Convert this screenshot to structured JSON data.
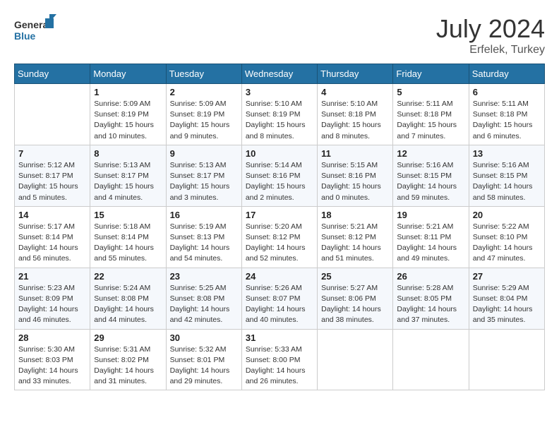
{
  "header": {
    "logo_line1": "General",
    "logo_line2": "Blue",
    "month_year": "July 2024",
    "location": "Erfelek, Turkey"
  },
  "weekdays": [
    "Sunday",
    "Monday",
    "Tuesday",
    "Wednesday",
    "Thursday",
    "Friday",
    "Saturday"
  ],
  "weeks": [
    [
      {
        "day": "",
        "info": ""
      },
      {
        "day": "1",
        "info": "Sunrise: 5:09 AM\nSunset: 8:19 PM\nDaylight: 15 hours\nand 10 minutes."
      },
      {
        "day": "2",
        "info": "Sunrise: 5:09 AM\nSunset: 8:19 PM\nDaylight: 15 hours\nand 9 minutes."
      },
      {
        "day": "3",
        "info": "Sunrise: 5:10 AM\nSunset: 8:19 PM\nDaylight: 15 hours\nand 8 minutes."
      },
      {
        "day": "4",
        "info": "Sunrise: 5:10 AM\nSunset: 8:18 PM\nDaylight: 15 hours\nand 8 minutes."
      },
      {
        "day": "5",
        "info": "Sunrise: 5:11 AM\nSunset: 8:18 PM\nDaylight: 15 hours\nand 7 minutes."
      },
      {
        "day": "6",
        "info": "Sunrise: 5:11 AM\nSunset: 8:18 PM\nDaylight: 15 hours\nand 6 minutes."
      }
    ],
    [
      {
        "day": "7",
        "info": "Sunrise: 5:12 AM\nSunset: 8:17 PM\nDaylight: 15 hours\nand 5 minutes."
      },
      {
        "day": "8",
        "info": "Sunrise: 5:13 AM\nSunset: 8:17 PM\nDaylight: 15 hours\nand 4 minutes."
      },
      {
        "day": "9",
        "info": "Sunrise: 5:13 AM\nSunset: 8:17 PM\nDaylight: 15 hours\nand 3 minutes."
      },
      {
        "day": "10",
        "info": "Sunrise: 5:14 AM\nSunset: 8:16 PM\nDaylight: 15 hours\nand 2 minutes."
      },
      {
        "day": "11",
        "info": "Sunrise: 5:15 AM\nSunset: 8:16 PM\nDaylight: 15 hours\nand 0 minutes."
      },
      {
        "day": "12",
        "info": "Sunrise: 5:16 AM\nSunset: 8:15 PM\nDaylight: 14 hours\nand 59 minutes."
      },
      {
        "day": "13",
        "info": "Sunrise: 5:16 AM\nSunset: 8:15 PM\nDaylight: 14 hours\nand 58 minutes."
      }
    ],
    [
      {
        "day": "14",
        "info": "Sunrise: 5:17 AM\nSunset: 8:14 PM\nDaylight: 14 hours\nand 56 minutes."
      },
      {
        "day": "15",
        "info": "Sunrise: 5:18 AM\nSunset: 8:14 PM\nDaylight: 14 hours\nand 55 minutes."
      },
      {
        "day": "16",
        "info": "Sunrise: 5:19 AM\nSunset: 8:13 PM\nDaylight: 14 hours\nand 54 minutes."
      },
      {
        "day": "17",
        "info": "Sunrise: 5:20 AM\nSunset: 8:12 PM\nDaylight: 14 hours\nand 52 minutes."
      },
      {
        "day": "18",
        "info": "Sunrise: 5:21 AM\nSunset: 8:12 PM\nDaylight: 14 hours\nand 51 minutes."
      },
      {
        "day": "19",
        "info": "Sunrise: 5:21 AM\nSunset: 8:11 PM\nDaylight: 14 hours\nand 49 minutes."
      },
      {
        "day": "20",
        "info": "Sunrise: 5:22 AM\nSunset: 8:10 PM\nDaylight: 14 hours\nand 47 minutes."
      }
    ],
    [
      {
        "day": "21",
        "info": "Sunrise: 5:23 AM\nSunset: 8:09 PM\nDaylight: 14 hours\nand 46 minutes."
      },
      {
        "day": "22",
        "info": "Sunrise: 5:24 AM\nSunset: 8:08 PM\nDaylight: 14 hours\nand 44 minutes."
      },
      {
        "day": "23",
        "info": "Sunrise: 5:25 AM\nSunset: 8:08 PM\nDaylight: 14 hours\nand 42 minutes."
      },
      {
        "day": "24",
        "info": "Sunrise: 5:26 AM\nSunset: 8:07 PM\nDaylight: 14 hours\nand 40 minutes."
      },
      {
        "day": "25",
        "info": "Sunrise: 5:27 AM\nSunset: 8:06 PM\nDaylight: 14 hours\nand 38 minutes."
      },
      {
        "day": "26",
        "info": "Sunrise: 5:28 AM\nSunset: 8:05 PM\nDaylight: 14 hours\nand 37 minutes."
      },
      {
        "day": "27",
        "info": "Sunrise: 5:29 AM\nSunset: 8:04 PM\nDaylight: 14 hours\nand 35 minutes."
      }
    ],
    [
      {
        "day": "28",
        "info": "Sunrise: 5:30 AM\nSunset: 8:03 PM\nDaylight: 14 hours\nand 33 minutes."
      },
      {
        "day": "29",
        "info": "Sunrise: 5:31 AM\nSunset: 8:02 PM\nDaylight: 14 hours\nand 31 minutes."
      },
      {
        "day": "30",
        "info": "Sunrise: 5:32 AM\nSunset: 8:01 PM\nDaylight: 14 hours\nand 29 minutes."
      },
      {
        "day": "31",
        "info": "Sunrise: 5:33 AM\nSunset: 8:00 PM\nDaylight: 14 hours\nand 26 minutes."
      },
      {
        "day": "",
        "info": ""
      },
      {
        "day": "",
        "info": ""
      },
      {
        "day": "",
        "info": ""
      }
    ]
  ]
}
